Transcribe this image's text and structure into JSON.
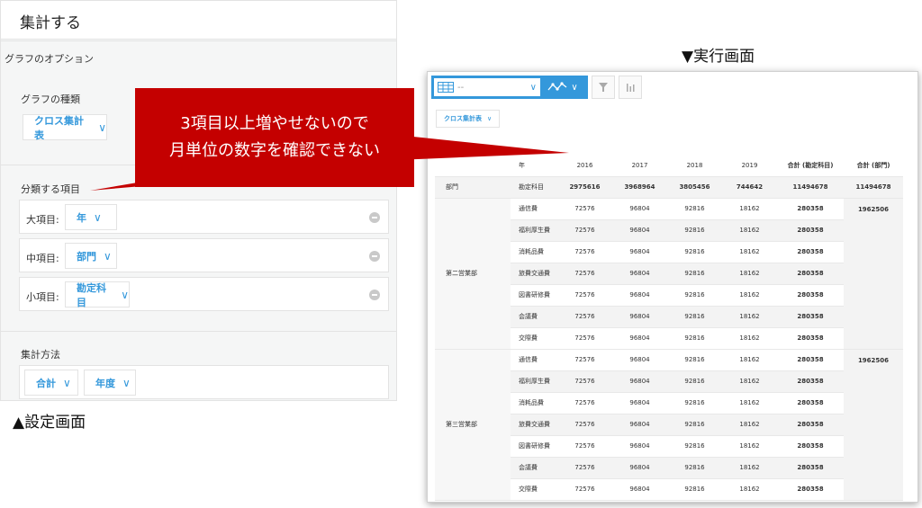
{
  "settings": {
    "title": "集計する",
    "options_title": "グラフのオプション",
    "graph_type": {
      "label": "グラフの種類",
      "value": "クロス集計表"
    },
    "classify": {
      "label": "分類する項目",
      "rows": [
        {
          "label": "大項目:",
          "value": "年"
        },
        {
          "label": "中項目:",
          "value": "部門"
        },
        {
          "label": "小項目:",
          "value": "勘定科目"
        }
      ]
    },
    "method": {
      "label": "集計方法",
      "agg": "合計",
      "period": "年度"
    },
    "caption": "▲設定画面"
  },
  "callout": {
    "line1": "3項目以上増やせないので",
    "line2": "月単位の数字を確認できない"
  },
  "run": {
    "caption": "▼実行画面",
    "toolbar": {
      "view_value": "--",
      "graph_icon": "line-graph-icon",
      "filter_icon": "filter-icon",
      "bar_icon": "bar-chart-icon"
    },
    "graph_type": "クロス集計表",
    "headers": {
      "year": "年",
      "years": [
        "2016",
        "2017",
        "2018",
        "2019"
      ],
      "total_item": "合計 (勘定科目)",
      "total_dept": "合計 (部門)"
    },
    "summary": {
      "dept": "部門",
      "item": "勘定科目",
      "values": [
        "2975616",
        "3968964",
        "3805456",
        "744642"
      ],
      "total": "11494678",
      "dept_total": "11494678"
    },
    "groups": [
      {
        "dept": "第二営業部",
        "dept_total": "1962506",
        "rows": [
          {
            "item": "通信費",
            "values": [
              "72576",
              "96804",
              "92816",
              "18162"
            ],
            "total": "280358"
          },
          {
            "item": "福利厚生費",
            "values": [
              "72576",
              "96804",
              "92816",
              "18162"
            ],
            "total": "280358"
          },
          {
            "item": "消耗品費",
            "values": [
              "72576",
              "96804",
              "92816",
              "18162"
            ],
            "total": "280358"
          },
          {
            "item": "旅費交通費",
            "values": [
              "72576",
              "96804",
              "92816",
              "18162"
            ],
            "total": "280358"
          },
          {
            "item": "図書研修費",
            "values": [
              "72576",
              "96804",
              "92816",
              "18162"
            ],
            "total": "280358"
          },
          {
            "item": "会議費",
            "values": [
              "72576",
              "96804",
              "92816",
              "18162"
            ],
            "total": "280358"
          },
          {
            "item": "交際費",
            "values": [
              "72576",
              "96804",
              "92816",
              "18162"
            ],
            "total": "280358"
          }
        ]
      },
      {
        "dept": "第三営業部",
        "dept_total": "1962506",
        "rows": [
          {
            "item": "通信費",
            "values": [
              "72576",
              "96804",
              "92816",
              "18162"
            ],
            "total": "280358"
          },
          {
            "item": "福利厚生費",
            "values": [
              "72576",
              "96804",
              "92816",
              "18162"
            ],
            "total": "280358"
          },
          {
            "item": "消耗品費",
            "values": [
              "72576",
              "96804",
              "92816",
              "18162"
            ],
            "total": "280358"
          },
          {
            "item": "旅費交通費",
            "values": [
              "72576",
              "96804",
              "92816",
              "18162"
            ],
            "total": "280358"
          },
          {
            "item": "図書研修費",
            "values": [
              "72576",
              "96804",
              "92816",
              "18162"
            ],
            "total": "280358"
          },
          {
            "item": "会議費",
            "values": [
              "72576",
              "96804",
              "92816",
              "18162"
            ],
            "total": "280358"
          },
          {
            "item": "交際費",
            "values": [
              "72576",
              "96804",
              "92816",
              "18162"
            ],
            "total": "280358"
          }
        ]
      }
    ]
  }
}
